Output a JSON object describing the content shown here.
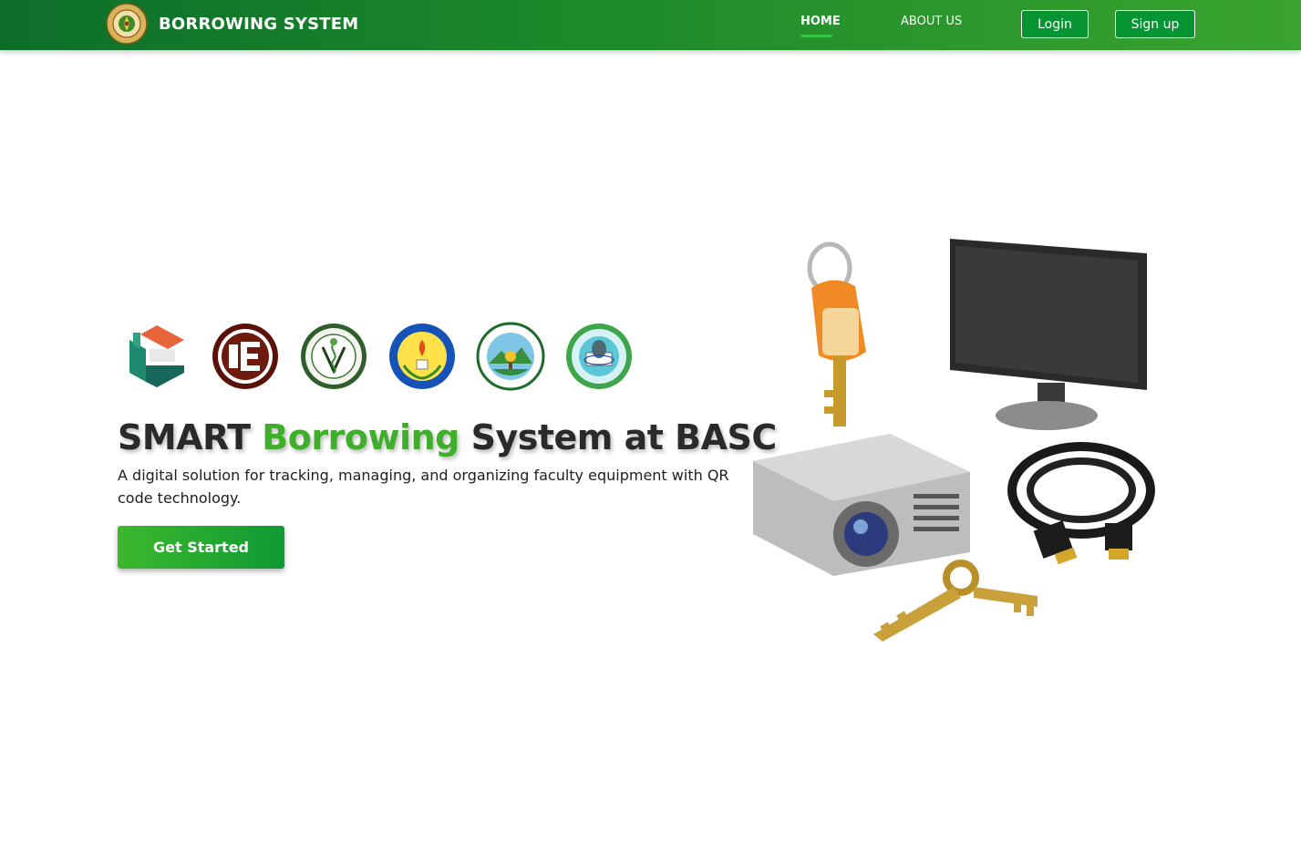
{
  "navbar": {
    "brand_title": "BORROWING SYSTEM",
    "links": {
      "home": "HOME",
      "about": "ABOUT US"
    },
    "buttons": {
      "login": "Login",
      "signup": "Sign up"
    }
  },
  "hero": {
    "title_part1": "SMART ",
    "title_accent": "Borrowing",
    "title_part2": " System at BASC",
    "description": "A digital solution for tracking, managing, and organizing faculty equipment with QR code technology.",
    "cta_label": "Get Started"
  },
  "seals": [
    "institute-seal-1",
    "engineering-seal",
    "agriculture-veterinary-seal",
    "education-seal",
    "management-seal",
    "arts-sciences-seal"
  ],
  "illustration": [
    "orange-key",
    "monitor",
    "projector",
    "hdmi-cable",
    "gold-key"
  ],
  "colors": {
    "nav_start": "#0d6e2a",
    "nav_end": "#3aa32e",
    "accent": "#3fae2a",
    "button": "#079433"
  }
}
